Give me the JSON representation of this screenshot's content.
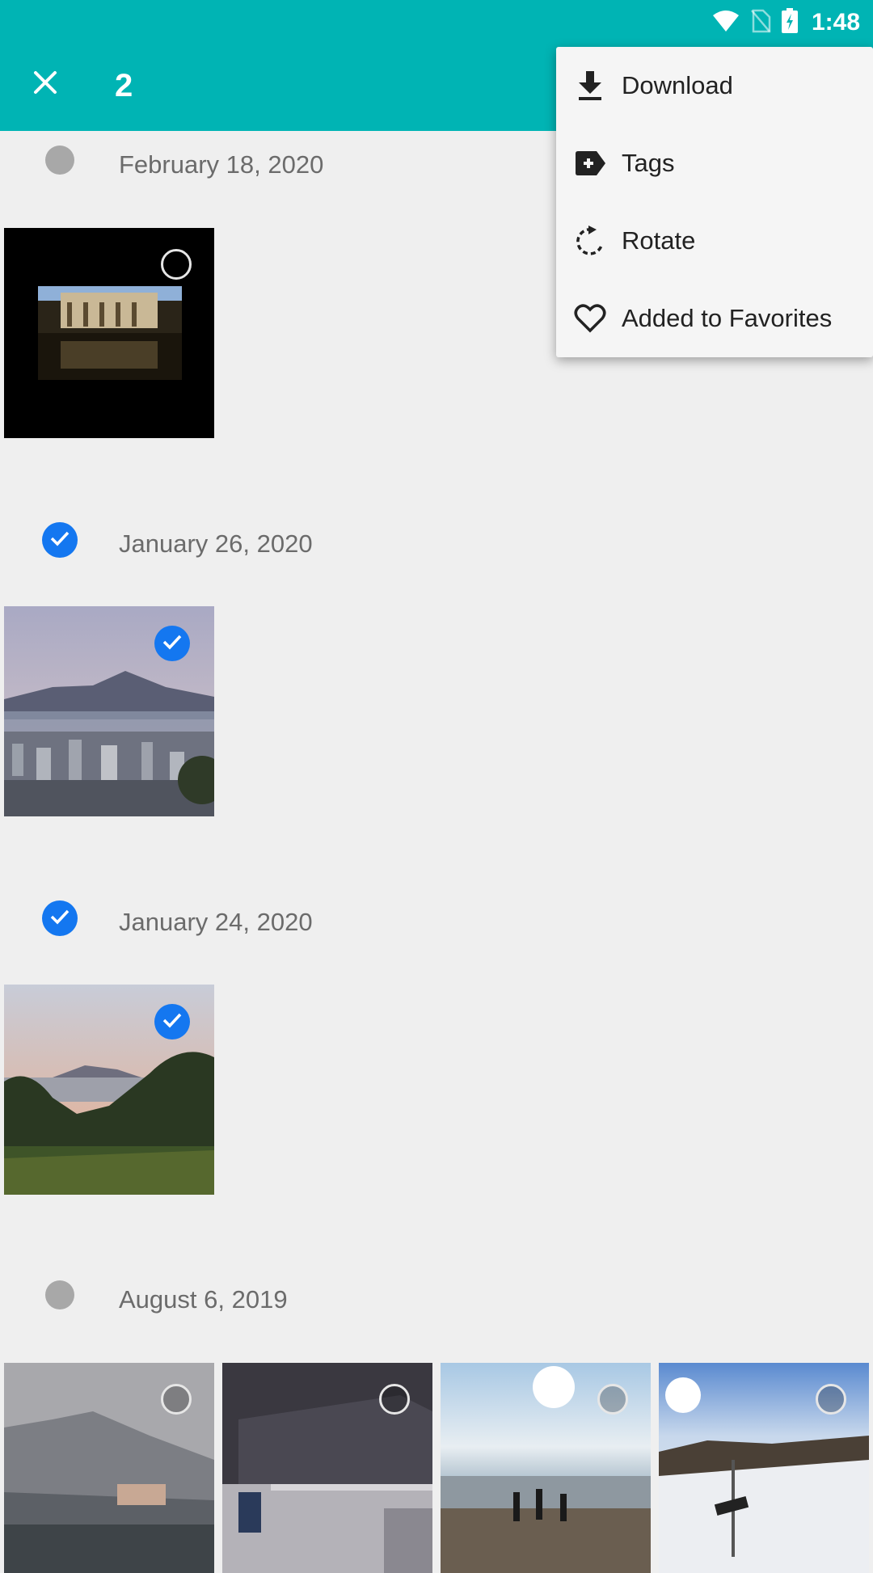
{
  "status": {
    "time": "1:48"
  },
  "toolbar": {
    "selected_count": "2"
  },
  "menu": {
    "items": [
      {
        "label": "Download",
        "icon": "download-icon"
      },
      {
        "label": "Tags",
        "icon": "tag-add-icon"
      },
      {
        "label": "Rotate",
        "icon": "rotate-icon"
      },
      {
        "label": "Added to Favorites",
        "icon": "heart-icon"
      }
    ]
  },
  "sections": [
    {
      "date": "February 18, 2020",
      "selected": false,
      "photos": [
        {
          "selected": false
        }
      ]
    },
    {
      "date": "January 26, 2020",
      "selected": true,
      "photos": [
        {
          "selected": true
        }
      ]
    },
    {
      "date": "January 24, 2020",
      "selected": true,
      "photos": [
        {
          "selected": true
        }
      ]
    },
    {
      "date": "August 6, 2019",
      "selected": false,
      "photos": [
        {
          "selected": false
        },
        {
          "selected": false
        },
        {
          "selected": false
        },
        {
          "selected": false
        }
      ]
    }
  ],
  "colors": {
    "appbar": "#00b4b4",
    "accent": "#1477f0",
    "background": "#efefef"
  }
}
